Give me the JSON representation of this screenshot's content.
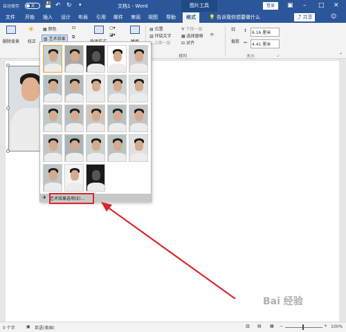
{
  "titlebar": {
    "autosave_label": "自动保存",
    "autosave_state": "关",
    "title": "文档1 - Word",
    "context_tool": "图片工具",
    "login": "登录",
    "save_icon": "save-icon",
    "undo_icon": "undo-icon",
    "redo_icon": "redo-icon"
  },
  "tabs": [
    "文件",
    "开始",
    "插入",
    "设计",
    "布局",
    "引用",
    "邮件",
    "审阅",
    "视图",
    "帮助"
  ],
  "active_tab": "格式",
  "tell_me": "告诉我你想要做什么",
  "share": "共享",
  "ribbon": {
    "remove_bg": "删除背景",
    "corrections": "校正",
    "color": "颜色",
    "artistic_effects": "艺术效果",
    "quick_styles": "快速样式",
    "arrange_position": "位置",
    "wrap_text": "环绕文字",
    "bring_forward": "上移一层",
    "send_backward": "下移一层",
    "selection_pane": "选择窗格",
    "align": "对齐",
    "arrange_group": "排列",
    "crop": "裁剪",
    "height": "6.16 厘米",
    "width": "4.41 厘米",
    "size_group": "大小",
    "alt_text": "替换"
  },
  "gallery": {
    "footer_label": "艺术效果选项(E)...",
    "rows": 6,
    "cols": 5
  },
  "statusbar": {
    "words": "0 个字",
    "language": "英语(美国)",
    "zoom": "100%"
  },
  "watermark": "Bai 经验"
}
